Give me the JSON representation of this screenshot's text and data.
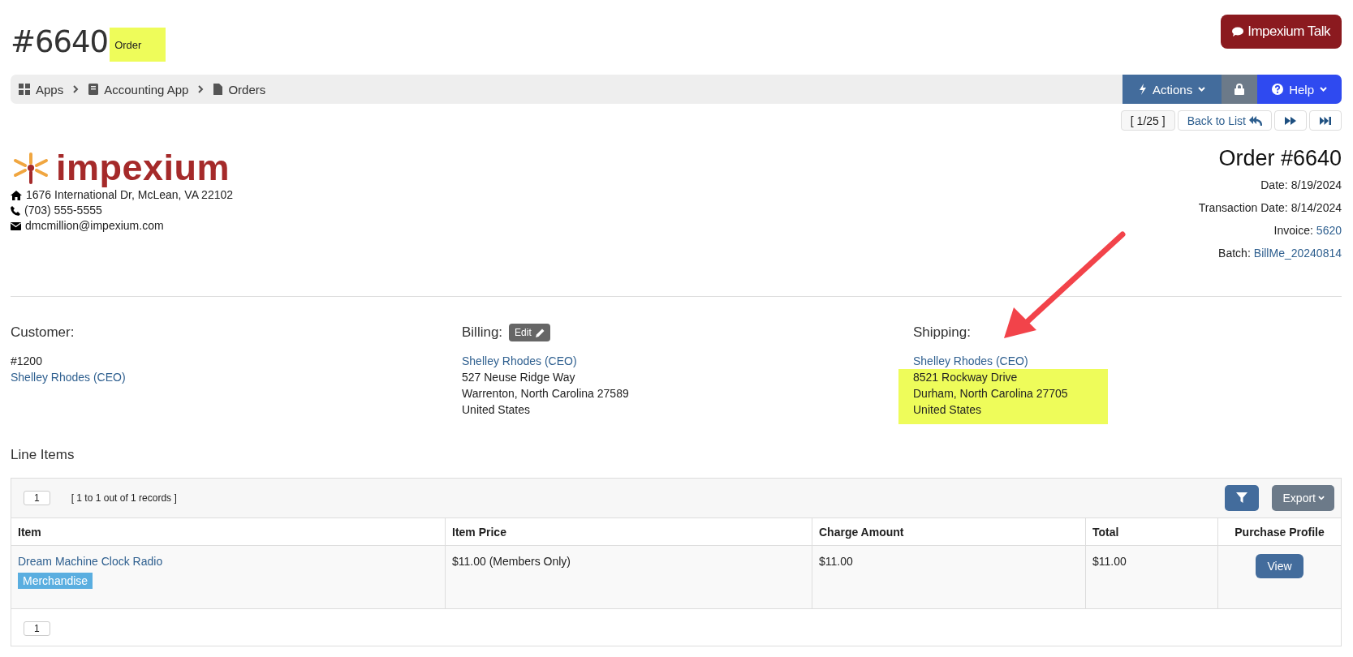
{
  "header": {
    "title": "#6640",
    "subtitle": "Order",
    "subtitle_highlight": true,
    "talk_button": "Impexium Talk"
  },
  "breadcrumb": [
    {
      "label": "Apps"
    },
    {
      "label": "Accounting App"
    },
    {
      "label": "Orders"
    }
  ],
  "toolbar": {
    "actions": "Actions",
    "help": "Help"
  },
  "pager": {
    "position": "[ 1/25 ]",
    "back": "Back to List"
  },
  "company": {
    "logo_text": "impexium",
    "address": "1676 International Dr, McLean, VA 22102",
    "phone": "(703) 555-5555",
    "email": "dmcmillion@impexium.com"
  },
  "order": {
    "title": "Order #6640",
    "fields": [
      {
        "label": "Date:",
        "value": "8/19/2024",
        "link": false
      },
      {
        "label": "Transaction Date:",
        "value": "8/14/2024",
        "link": false
      },
      {
        "label": "Invoice:",
        "value": "5620",
        "link": true
      },
      {
        "label": "Batch:",
        "value": "BillMe_20240814",
        "link": true
      }
    ]
  },
  "customer": {
    "heading": "Customer:",
    "number": "#1200",
    "name": "Shelley Rhodes (CEO)"
  },
  "billing": {
    "heading": "Billing:",
    "edit": "Edit",
    "name": "Shelley Rhodes (CEO)",
    "lines": [
      "527 Neuse Ridge Way",
      "Warrenton, North Carolina 27589",
      "United States"
    ],
    "highlight": false
  },
  "shipping": {
    "heading": "Shipping:",
    "name": "Shelley Rhodes (CEO)",
    "lines": [
      "8521 Rockway Drive",
      "Durham, North Carolina 27705",
      "United States"
    ],
    "highlight": true
  },
  "line_items": {
    "heading": "Line Items",
    "page": "1",
    "records_info": "[ 1 to 1 out of 1 records ]",
    "export": "Export",
    "columns": [
      "Item",
      "Item Price",
      "Charge Amount",
      "Total",
      "Purchase Profile"
    ],
    "rows": [
      {
        "item": "Dream Machine Clock Radio",
        "tag": "Merchandise",
        "price": "$11.00 (Members Only)",
        "charge": "$11.00",
        "total": "$11.00",
        "action": "View"
      }
    ],
    "footer_page": "1"
  }
}
